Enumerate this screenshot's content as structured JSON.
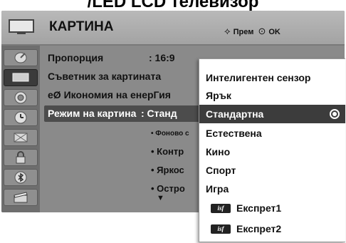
{
  "document_heading": "/LED LCD телевизор",
  "header": {
    "title": "КАРТИНА",
    "hint_move_symbol": "⟡",
    "hint_move": "Прем",
    "hint_ok_symbol": "⊙",
    "hint_ok": "OK"
  },
  "sidebar": {
    "items": [
      {
        "name": "satellite-dish-icon",
        "glyph": "◔"
      },
      {
        "name": "picture-tv-icon",
        "glyph": "▭"
      },
      {
        "name": "audio-speaker-icon",
        "glyph": "◎"
      },
      {
        "name": "time-clock-icon",
        "glyph": "◷"
      },
      {
        "name": "option-box-icon",
        "glyph": "⊠"
      },
      {
        "name": "lock-icon",
        "glyph": "🔒"
      },
      {
        "name": "bluetooth-icon",
        "glyph": "✱"
      },
      {
        "name": "usb-movie-icon",
        "glyph": "▦"
      }
    ]
  },
  "menu": {
    "rows": [
      {
        "label": "Пропорция",
        "value": ": 16:9"
      },
      {
        "label": "Съветник за картината",
        "value": ""
      },
      {
        "label": "eØ Икономия на енерГия",
        "value": ""
      },
      {
        "label": "Режим на картина",
        "value": ": Станд"
      }
    ],
    "sub_items": [
      "• Фоново с",
      "• Контр",
      "• Яркос",
      "• Остро"
    ],
    "more_arrow": "▼"
  },
  "popup": {
    "options": [
      {
        "label": "Интелигентен сензор",
        "selected": false,
        "isf": false
      },
      {
        "label": "Ярък",
        "selected": false,
        "isf": false
      },
      {
        "label": "Стандартна",
        "selected": true,
        "isf": false
      },
      {
        "label": "Естествена",
        "selected": false,
        "isf": false
      },
      {
        "label": "Кино",
        "selected": false,
        "isf": false
      },
      {
        "label": "Спорт",
        "selected": false,
        "isf": false
      },
      {
        "label": "Игра",
        "selected": false,
        "isf": false
      },
      {
        "label": "Експрет1",
        "selected": false,
        "isf": true
      },
      {
        "label": "Експрет2",
        "selected": false,
        "isf": true
      }
    ],
    "isf_badge": "isf"
  },
  "colors": {
    "osd_gray": "#8a8a8a",
    "selection": "#3c3c3c",
    "popup_bg": "#ffffff"
  }
}
